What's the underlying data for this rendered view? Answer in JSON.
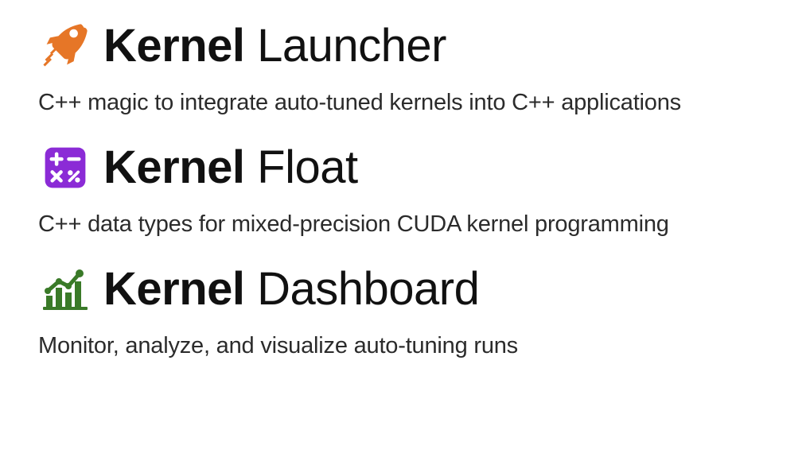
{
  "products": [
    {
      "title_bold": "Kernel",
      "title_thin": "Launcher",
      "description": "C++ magic to integrate auto-tuned kernels into C++ applications",
      "icon": "rocket",
      "icon_color": "#e67627"
    },
    {
      "title_bold": "Kernel",
      "title_thin": "Float",
      "description": "C++ data types for mixed-precision CUDA kernel programming",
      "icon": "math-ops",
      "icon_color": "#8b2bd6"
    },
    {
      "title_bold": "Kernel",
      "title_thin": "Dashboard",
      "description": "Monitor, analyze, and visualize auto-tuning runs",
      "icon": "chart",
      "icon_color": "#3a7a28"
    }
  ]
}
